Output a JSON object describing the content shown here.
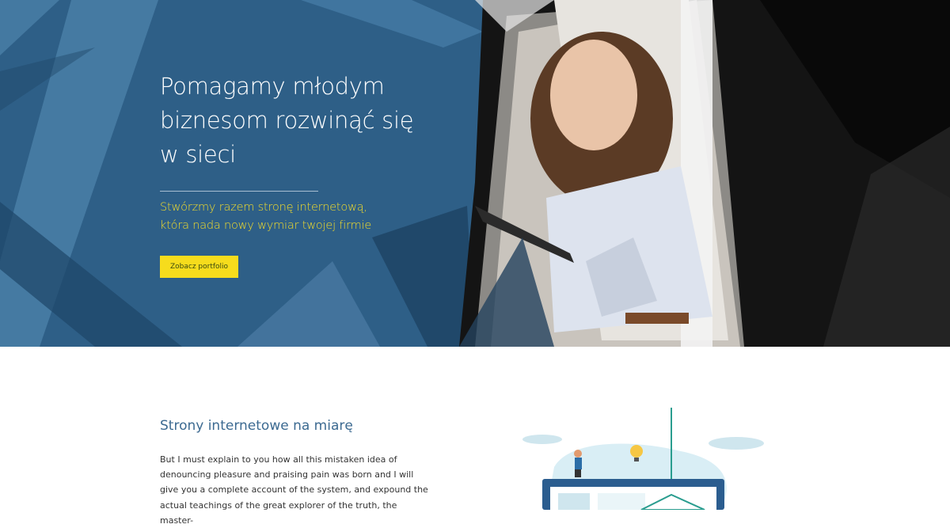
{
  "hero": {
    "title_line1": "Pomagamy młodym",
    "title_line2": "biznesom rozwinąć się",
    "title_line3": "w sieci",
    "subtitle_line1": "Stwórzmy razem stronę internetową,",
    "subtitle_line2": "która nada nowy wymiar twojej firmie",
    "button_label": "Zobacz portfolio",
    "colors": {
      "background": "#2e5f87",
      "accent": "#f6dc1c"
    }
  },
  "section": {
    "heading": "Strony internetowe na miarę",
    "body_lines": [
      "But I must explain to you how all this mistaken idea of",
      "denouncing pleasure and praising pain was born and I will",
      "give you a complete account of the system, and expound the",
      "actual teachings of the great explorer of the truth, the master-"
    ],
    "illustration": "web-design-illustration"
  }
}
